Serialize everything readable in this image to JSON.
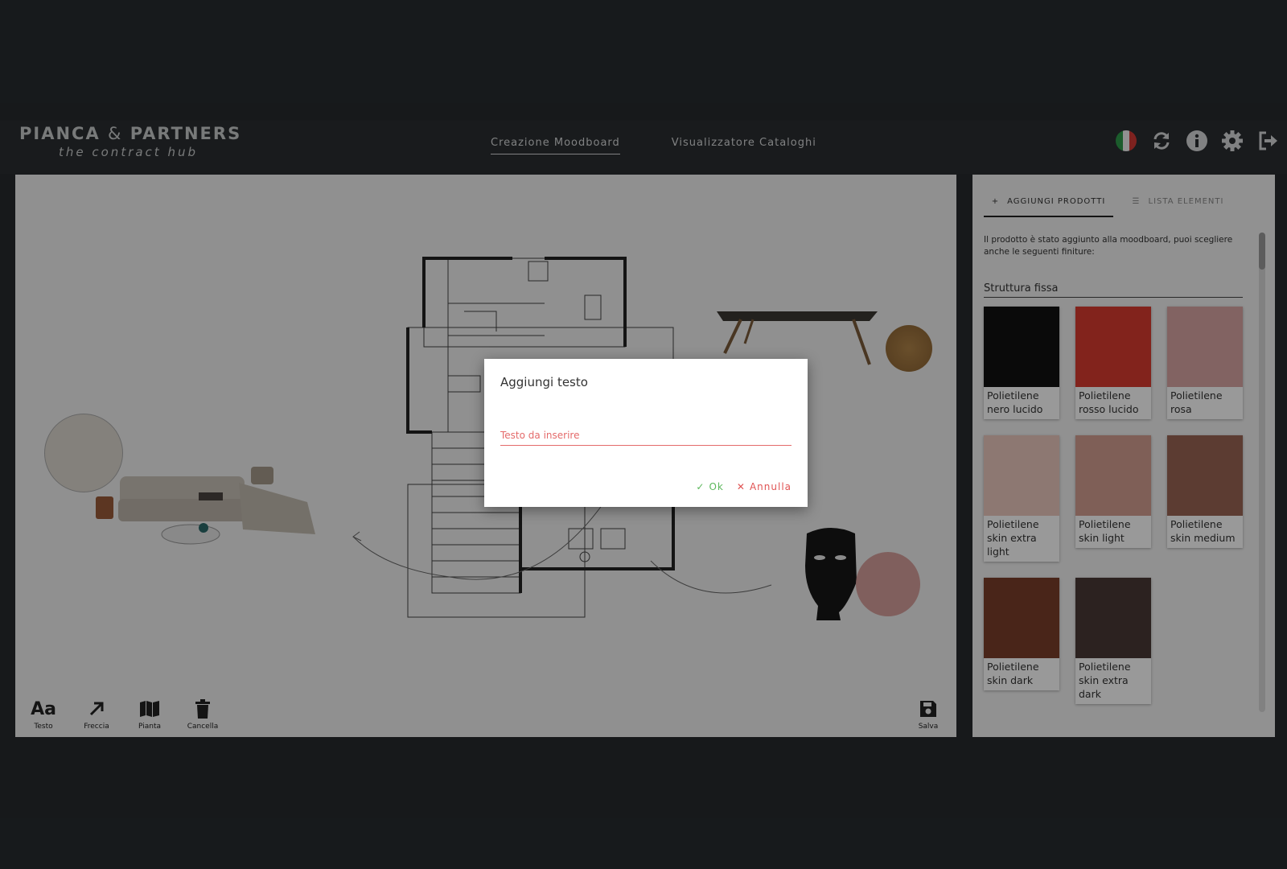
{
  "brand": {
    "name": "PIANCA",
    "amp": "&",
    "partners": "PARTNERS",
    "tagline": "the contract hub"
  },
  "nav": [
    {
      "label": "Creazione Moodboard",
      "active": true
    },
    {
      "label": "Visualizzatore Cataloghi",
      "active": false
    }
  ],
  "header_icons": [
    "italy-flag-icon",
    "refresh-icon",
    "info-icon",
    "gear-icon",
    "logout-icon"
  ],
  "toolbar": {
    "tools": [
      {
        "label": "Testo",
        "icon": "text-icon"
      },
      {
        "label": "Freccia",
        "icon": "arrow-icon"
      },
      {
        "label": "Pianta",
        "icon": "map-icon"
      },
      {
        "label": "Cancella",
        "icon": "trash-icon"
      }
    ],
    "save_label": "Salva"
  },
  "panel": {
    "tabs": [
      {
        "label": "AGGIUNGI PRODOTTI",
        "icon": "plus-icon",
        "active": true
      },
      {
        "label": "LISTA ELEMENTI",
        "icon": "list-icon",
        "active": false
      }
    ],
    "message": "Il prodotto è stato aggiunto alla moodboard, puoi scegliere anche le seguenti finiture:",
    "section_title": "Struttura fissa",
    "swatches": [
      {
        "label": "Polietilene nero lucido",
        "color": "#111111"
      },
      {
        "label": "Polietilene rosso lucido",
        "color": "#d93b2f"
      },
      {
        "label": "Polietilene rosa",
        "color": "#d9a6a3"
      },
      {
        "label": "Polietilene skin extra light",
        "color": "#ecc9be"
      },
      {
        "label": "Polietilene skin light",
        "color": "#d49e92"
      },
      {
        "label": "Polietilene skin medium",
        "color": "#9a6454"
      },
      {
        "label": "Polietilene skin dark",
        "color": "#7a3f2b"
      },
      {
        "label": "Polietilene skin extra dark",
        "color": "#4a3a36"
      }
    ]
  },
  "dialog": {
    "title": "Aggiungi testo",
    "input_placeholder": "Testo da inserire",
    "ok_label": "Ok",
    "cancel_label": "Annulla"
  },
  "colors": {
    "background": "#272b2e",
    "accent_red": "#e46a6a",
    "ok_green": "#5cb85c"
  }
}
